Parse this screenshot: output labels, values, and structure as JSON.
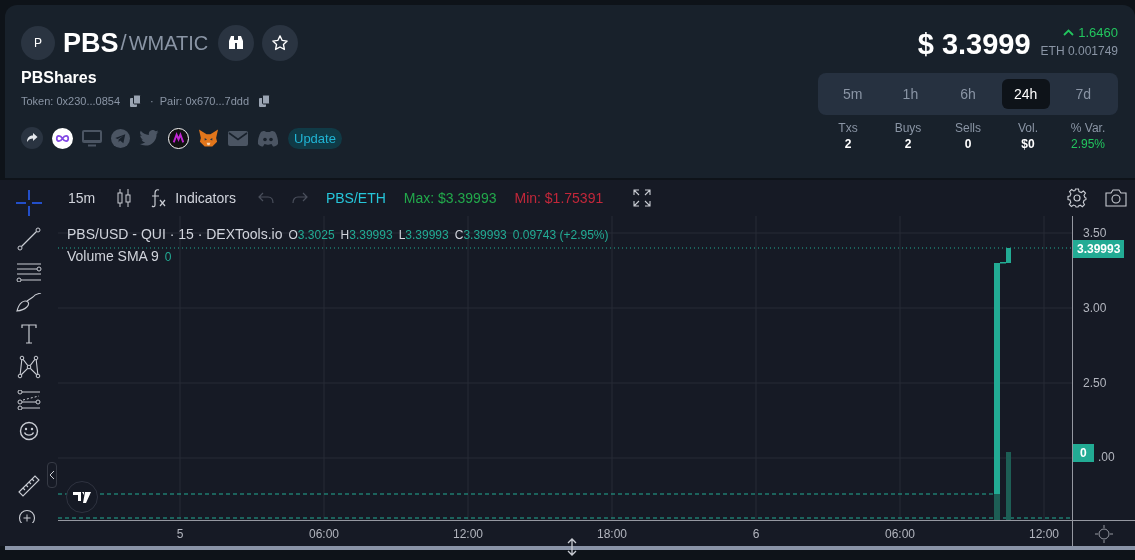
{
  "pair": {
    "avatar": "P",
    "base": "PBS",
    "separator": "/",
    "quote": "WMATIC",
    "name": "PBShares",
    "token": "Token: 0x230...0854",
    "dot": "·",
    "pair": "Pair: 0x670...7ddd",
    "update": "Update"
  },
  "price": {
    "value": "$ 3.3999",
    "change": "1.6460",
    "eth": "ETH 0.001749"
  },
  "ranges": [
    {
      "label": "5m",
      "selected": false
    },
    {
      "label": "1h",
      "selected": false
    },
    {
      "label": "6h",
      "selected": false
    },
    {
      "label": "24h",
      "selected": true
    },
    {
      "label": "7d",
      "selected": false
    }
  ],
  "stats": [
    {
      "label": "Txs",
      "value": "2",
      "positive": false
    },
    {
      "label": "Buys",
      "value": "2",
      "positive": false
    },
    {
      "label": "Sells",
      "value": "0",
      "positive": false
    },
    {
      "label": "Vol.",
      "value": "$0",
      "positive": false
    },
    {
      "label": "% Var.",
      "value": "2.95%",
      "positive": true
    }
  ],
  "chart": {
    "interval": "15m",
    "indicators": "Indicators",
    "symbol": "PBS/ETH",
    "max": "Max: $3.39993",
    "min": "Min: $1.75391",
    "legend_title": "PBS/USD - QUI · 15 · DEXTools.io",
    "ohlc": [
      {
        "label": "O",
        "value": "3.3025"
      },
      {
        "label": "H",
        "value": "3.39993"
      },
      {
        "label": "L",
        "value": "3.39993"
      },
      {
        "label": "C",
        "value": "3.39993"
      }
    ],
    "change": "0.09743 (+2.95%)",
    "volume_label": "Volume SMA 9",
    "volume_value": "0",
    "price_ticks": [
      "3.50",
      "3.00",
      "2.50"
    ],
    "price_tick_partial": ".00",
    "last_price": "3.39993",
    "volume_badge": "0",
    "time_ticks": [
      "5",
      "06:00",
      "12:00",
      "18:00",
      "6",
      "06:00",
      "12:00"
    ]
  }
}
